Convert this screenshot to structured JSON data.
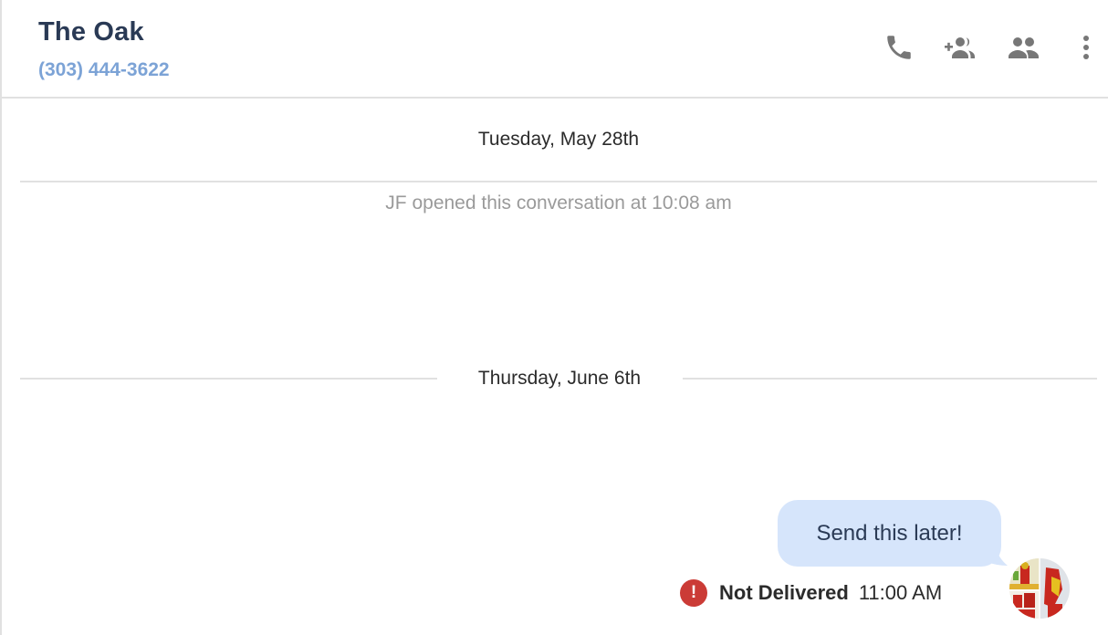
{
  "header": {
    "contact_name": "The Oak",
    "contact_phone": "(303) 444-3622",
    "actions": [
      {
        "name": "call",
        "icon": "phone-icon"
      },
      {
        "name": "add-participant",
        "icon": "group-add-icon"
      },
      {
        "name": "participants",
        "icon": "group-icon"
      },
      {
        "name": "more",
        "icon": "more-vertical-icon"
      }
    ]
  },
  "timeline": {
    "sections": [
      {
        "date": "Tuesday, May 28th",
        "events": [
          "JF opened this conversation at 10:08 am"
        ]
      },
      {
        "date": "Thursday, June 6th",
        "messages": [
          {
            "text": "Send this later!",
            "status": "Not Delivered",
            "time": "11:00 AM",
            "status_icon": "error-icon",
            "status_color": "#cb3b36",
            "bubble_color": "#d6e5fb",
            "sender_avatar": "avatar-image"
          }
        ]
      }
    ]
  },
  "colors": {
    "name": "#2a3a55",
    "phone": "#7ca3d6",
    "icon": "#777777",
    "divider": "#e1e1e1"
  }
}
